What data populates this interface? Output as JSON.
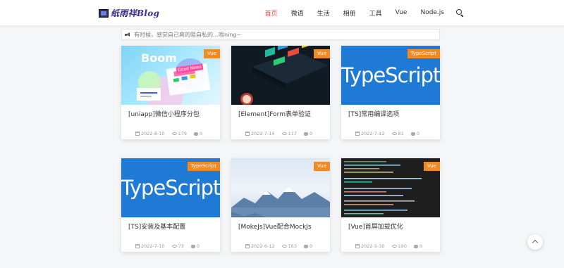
{
  "header": {
    "logo_text": "纸雨祥Blog",
    "nav": [
      "首页",
      "微语",
      "生活",
      "相册",
      "工具",
      "Vue",
      "Node.js"
    ],
    "active_nav": "首页"
  },
  "notice": {
    "text": "有时候，感觉自己爽的阻自私的…唔ning~"
  },
  "cards": [
    {
      "title": "[uniapp]微信小程序分包",
      "tag": "Vue",
      "date": "2022-8-10",
      "views": "179",
      "comments": "0",
      "thumb_text": "Boom",
      "thumb_sub": "Good News"
    },
    {
      "title": "[Element]Form表单验证",
      "tag": "Vue",
      "date": "2022-7-14",
      "views": "117",
      "comments": "0"
    },
    {
      "title": "[TS]常用编译选项",
      "tag": "TypeScript",
      "date": "2022-7-12",
      "views": "81",
      "comments": "0",
      "thumb_text": "TypeScript"
    },
    {
      "title": "[TS]安装及基本配置",
      "tag": "TypeScript",
      "date": "2022-7-10",
      "views": "73",
      "comments": "0",
      "thumb_text": "TypeScript"
    },
    {
      "title": "[MokeJs]Vue配合MockJs",
      "tag": "Vue",
      "date": "2022-6-12",
      "views": "163",
      "comments": "0"
    },
    {
      "title": "[Vue]首屏加载优化",
      "tag": "Vue",
      "date": "2022-5-30",
      "views": "160",
      "comments": "0"
    }
  ],
  "colors": {
    "accent": "#e74c3c",
    "tag": "#f08a24",
    "ts_blue": "#1f7ad6"
  }
}
